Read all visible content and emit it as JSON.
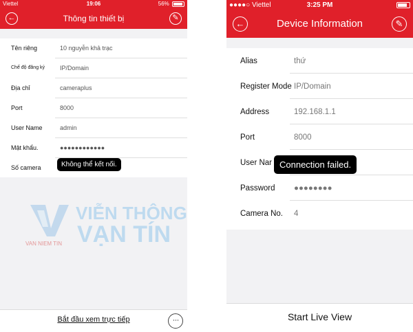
{
  "left_phone": {
    "statusbar": {
      "carrier": "Viettel",
      "time": "19:06",
      "battery": "56%"
    },
    "nav": {
      "title": "Thông tin thiết bị",
      "back_icon": "←",
      "edit_icon": "✎"
    },
    "rows": [
      {
        "label": "Tên riêng",
        "value": "10 nguyễn khả trạc"
      },
      {
        "label": "Chế độ đăng ký",
        "value": "IP/Domain"
      },
      {
        "label": "Địa chỉ",
        "value": "cameraplus"
      },
      {
        "label": "Port",
        "value": "8000"
      },
      {
        "label": "User Name",
        "value": "admin"
      },
      {
        "label": "Mật khẩu.",
        "value": "●●●●●●●●●●●●"
      },
      {
        "label": "Số camera",
        "value": ""
      }
    ],
    "toast": "Không thể kết nối.",
    "bottom": {
      "start_live": "Bắt đầu xem trực tiếp",
      "more_icon": "···"
    }
  },
  "right_phone": {
    "statusbar": {
      "carrier": "●●●●○ Viettel",
      "time": "3:25 PM",
      "battery": ""
    },
    "nav": {
      "title": "Device Information",
      "back_icon": "←",
      "edit_icon": "✎"
    },
    "rows": [
      {
        "label": "Alias",
        "value": "thứ"
      },
      {
        "label": "Register Mode",
        "value": "IP/Domain"
      },
      {
        "label": "Address",
        "value": "192.168.1.1"
      },
      {
        "label": "Port",
        "value": "8000"
      },
      {
        "label": "User Nar",
        "value": ""
      },
      {
        "label": "Password",
        "value": "●●●●●●●●"
      },
      {
        "label": "Camera No.",
        "value": "4"
      }
    ],
    "toast": "Connection failed.",
    "bottom": {
      "start_live": "Start Live View"
    }
  },
  "watermark": {
    "brand_line1": "VIỄN THÔNG",
    "brand_line2": "VẠN TÍN",
    "tagline": "VAN NIEM TIN",
    "color": "#a9d1ee"
  },
  "colors": {
    "accent": "#e0202a"
  }
}
